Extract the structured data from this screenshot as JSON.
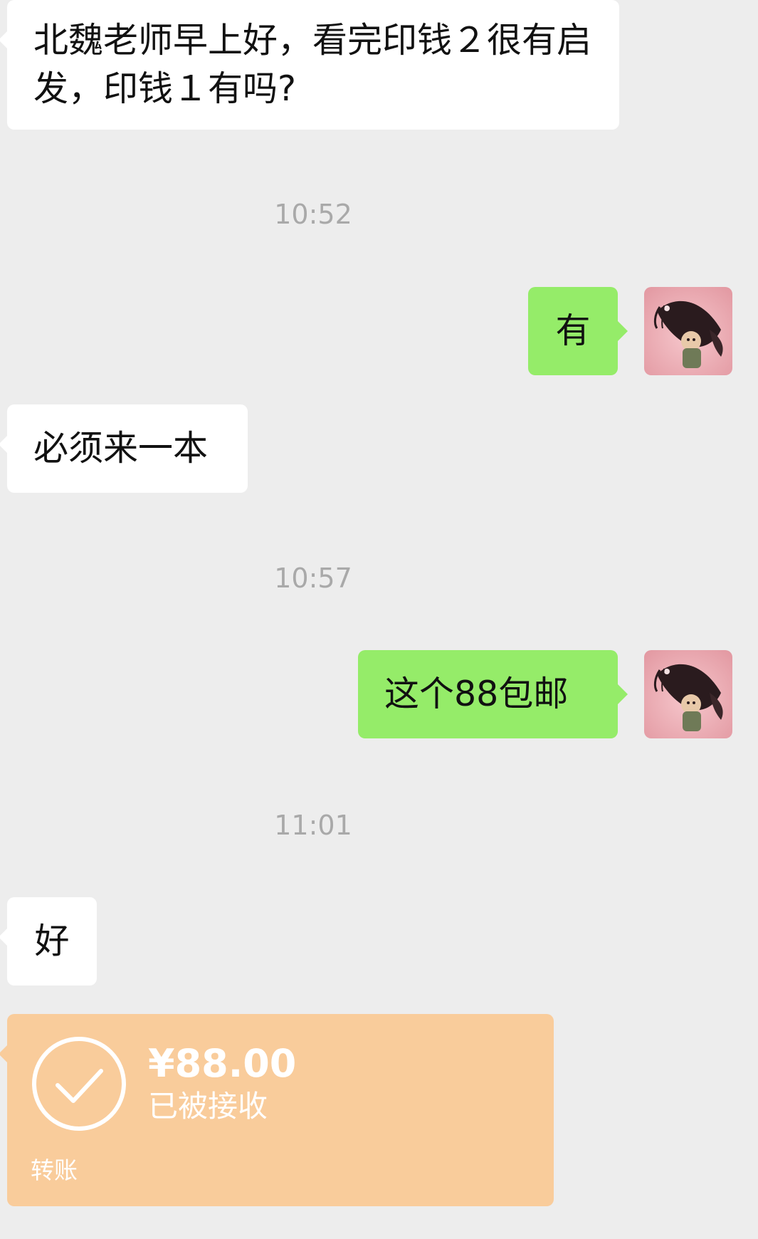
{
  "messages": {
    "m1": "北魏老师早上好，看完印钱２很有启发，印钱１有吗?",
    "m2": "有",
    "m3": "必须来一本",
    "m4": "这个88包邮",
    "m5": "好"
  },
  "timestamps": {
    "t1": "10:52",
    "t2": "10:57",
    "t3": "11:01"
  },
  "transfer": {
    "amount": "¥88.00",
    "status": "已被接收",
    "label": "转账"
  },
  "colors": {
    "background": "#ededed",
    "incoming_bubble": "#ffffff",
    "outgoing_bubble": "#95ec69",
    "transfer_card": "#f9cc9b",
    "timestamp_text": "#a9a9a9"
  }
}
